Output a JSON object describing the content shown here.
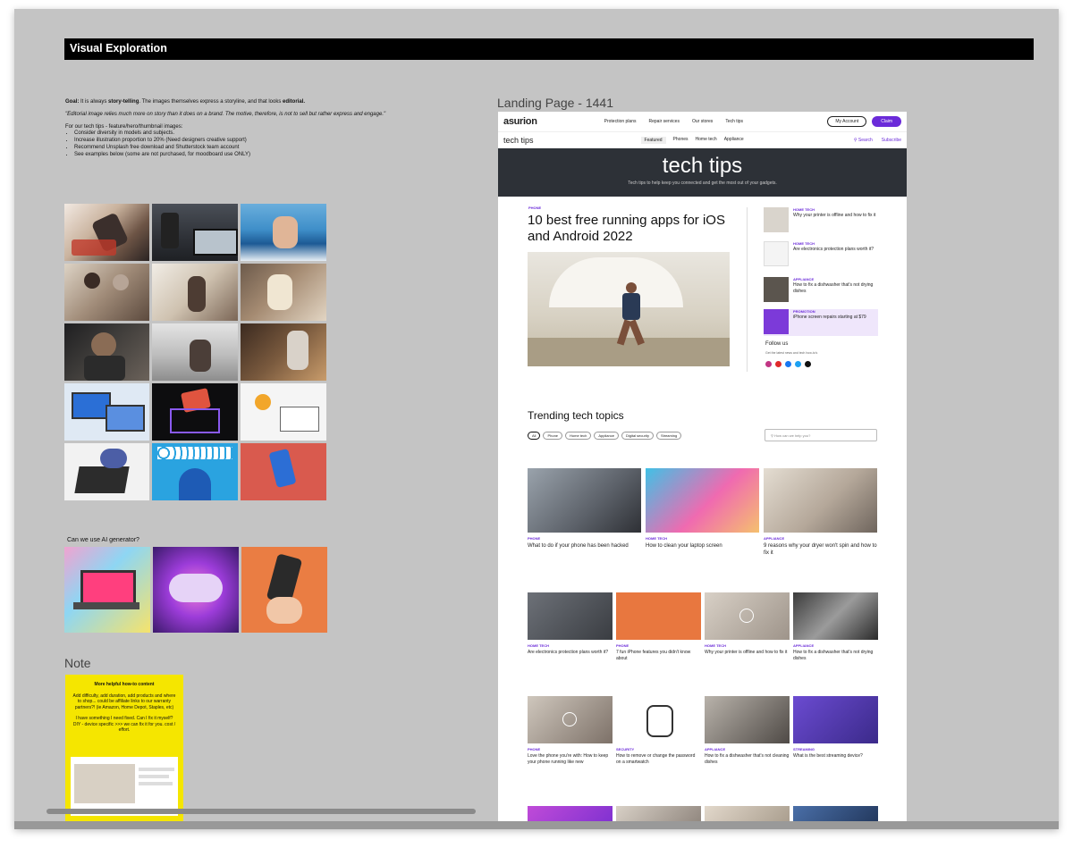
{
  "board": {
    "section_title": "Visual Exploration",
    "notes": {
      "goal_label": "Goal:",
      "goal_text_1": " It is always ",
      "goal_bold_1": "story-telling",
      "goal_text_2": ". The images themselves express a storyline, and that looks ",
      "goal_bold_2": "editorial.",
      "quote": "\"Editorial image relies much more on story than it does on a brand. The motive, therefore, is not to sell but rather express and engage.\"",
      "list_intro": "For our tech tips - feature/hero/thumbnail images:",
      "bullets": [
        "Consider diversity in models and subjects.",
        "Increase illustration proportion to 20% (Need designers creative support)",
        "Recommend Unsplash free download and Shutterstock team account",
        "See examples below (some are not purchased, for moodboard use ONLY)"
      ]
    },
    "moodboard_images": [
      "photo-phone-in-hand",
      "photo-speaker-laptop",
      "photo-thumbs-up-sea",
      "photo-couple-kitchen",
      "photo-family-room",
      "photo-woman-cooking",
      "photo-headphones-man",
      "photo-kitchen-laptop",
      "photo-man-cooking",
      "illustration-laptops",
      "illustration-vr-dark",
      "illustration-desk-person",
      "illustration-laptop-cloud",
      "illustration-facebook-eyes",
      "illustration-phone-red"
    ],
    "ai_label": "Can we use AI generator?",
    "ai_images": [
      "ai-laptop-colorful",
      "ai-gamepad-purple",
      "ai-phone-hand-orange"
    ],
    "note_label": "Note",
    "sticky": {
      "title": "More helpful how-to content",
      "p1": "Add difficulty, add duration, add products and where to shop... could be affiliate links to our warranty partners?! (ie Amazon, Home Depot, Staples, etc)",
      "p2": "I have something I need fixed. Can I fix it myself? DIY - device specific >>> we can fix it for you. cost / effort."
    }
  },
  "landing": {
    "frame_label": "Landing Page - 1441",
    "logo": "asurion",
    "nav_links": [
      "Protection plans",
      "Repair services",
      "Our stores",
      "Tech tips"
    ],
    "account_btn": "My Account",
    "join_btn": "Claim",
    "subnav_title": "tech tips",
    "subnav_tabs": [
      "Featured",
      "Phones",
      "Home tech",
      "Appliance"
    ],
    "search_link": "Search",
    "subscribe_link": "Subscribe",
    "hero_title": "tech tips",
    "hero_subtitle": "Tech tips to help keep you connected and get the most out of your gadgets.",
    "featured": {
      "tag": "PHONE",
      "title": "10 best free running apps for iOS and Android 2022"
    },
    "side_articles": [
      {
        "tag": "HOME TECH",
        "title": "Why your printer is offline and how to fix it"
      },
      {
        "tag": "HOME TECH",
        "title": "Are electronics protection plans worth it?"
      },
      {
        "tag": "APPLIANCE",
        "title": "How to fix a dishwasher that's not drying dishes"
      },
      {
        "tag": "PROMOTION",
        "title": "iPhone screen repairs starting at $79"
      }
    ],
    "follow_title": "Follow us",
    "follow_sub": "Get the latest news and tech how-to's",
    "trending_title": "Trending tech topics",
    "chips": [
      "All",
      "Phone",
      "Home tech",
      "Appliance",
      "Digital security",
      "Streaming"
    ],
    "search_placeholder": "How can we help you?",
    "row1": [
      {
        "tag": "PHONE",
        "title": "What to do if your phone has been hacked"
      },
      {
        "tag": "HOME TECH",
        "title": "How to clean your laptop screen"
      },
      {
        "tag": "APPLIANCE",
        "title": "9 reasons why your dryer won't spin and how to fix it"
      }
    ],
    "row2": [
      {
        "tag": "HOME TECH",
        "title": "Are electronics protection plans worth it?"
      },
      {
        "tag": "PHONE",
        "title": "7 fun iPhone features you didn't know about"
      },
      {
        "tag": "HOME TECH",
        "title": "Why your printer is offline and how to fix it"
      },
      {
        "tag": "APPLIANCE",
        "title": "How to fix a dishwasher that's not drying dishes"
      }
    ],
    "row3": [
      {
        "tag": "PHONE",
        "title": "Love the phone you're with: How to keep your phone running like new"
      },
      {
        "tag": "SECURITY",
        "title": "How to remove or change the password on a smartwatch"
      },
      {
        "tag": "APPLIANCE",
        "title": "How to fix a dishwasher that's not cleaning dishes"
      },
      {
        "tag": "STREAMING",
        "title": "What is the best streaming device?"
      }
    ],
    "colors": {
      "accent": "#6b2bd9",
      "hero_bg": "#2d3137",
      "canvas_bg": "#c4c4c4",
      "sticky": "#f5e600"
    }
  }
}
